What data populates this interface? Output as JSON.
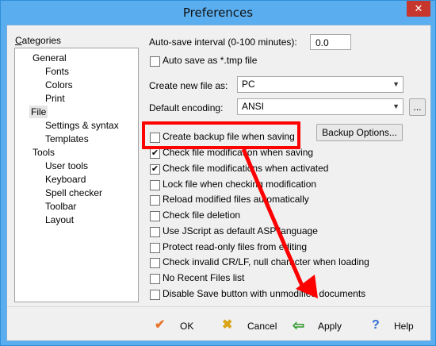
{
  "window": {
    "title": "Preferences",
    "close_glyph": "✕"
  },
  "categories": {
    "label": "Categories",
    "items": [
      {
        "label": "General"
      },
      {
        "label": "Fonts"
      },
      {
        "label": "Colors"
      },
      {
        "label": "Print"
      },
      {
        "label": "File",
        "selected": true
      },
      {
        "label": "Settings & syntax"
      },
      {
        "label": "Templates"
      },
      {
        "label": "Tools"
      },
      {
        "label": "User tools"
      },
      {
        "label": "Keyboard"
      },
      {
        "label": "Spell checker"
      },
      {
        "label": "Toolbar"
      },
      {
        "label": "Layout"
      }
    ]
  },
  "file_settings": {
    "autosave_interval_label": "Auto-save interval (0-100 minutes):",
    "autosave_interval_value": "0.0",
    "autosave_tmp_label": "Auto save as *.tmp file",
    "create_new_file_label": "Create new file as:",
    "create_new_file_value": "PC",
    "default_encoding_label": "Default encoding:",
    "default_encoding_value": "ANSI",
    "encoding_more_label": "...",
    "backup_options_label": "Backup Options...",
    "checkboxes": [
      {
        "label": "Create backup file when saving",
        "checked": false
      },
      {
        "label": "Check file modification when saving",
        "checked": true
      },
      {
        "label": "Check file modifications when activated",
        "checked": true
      },
      {
        "label": "Lock file when checking modification",
        "checked": false
      },
      {
        "label": "Reload modified files automatically",
        "checked": false
      },
      {
        "label": "Check file deletion",
        "checked": false
      },
      {
        "label": "Use JScript as default ASP language",
        "checked": false
      },
      {
        "label": "Protect read-only files from editing",
        "checked": false
      },
      {
        "label": "Check invalid CR/LF, null character when loading",
        "checked": false
      },
      {
        "label": "No Recent Files list",
        "checked": false
      },
      {
        "label": "Disable Save button with unmodified documents",
        "checked": false
      }
    ]
  },
  "footer": {
    "ok_label": "OK",
    "cancel_label": "Cancel",
    "apply_label": "Apply",
    "help_label": "Help"
  },
  "annotation": {
    "color": "#ff0000"
  }
}
